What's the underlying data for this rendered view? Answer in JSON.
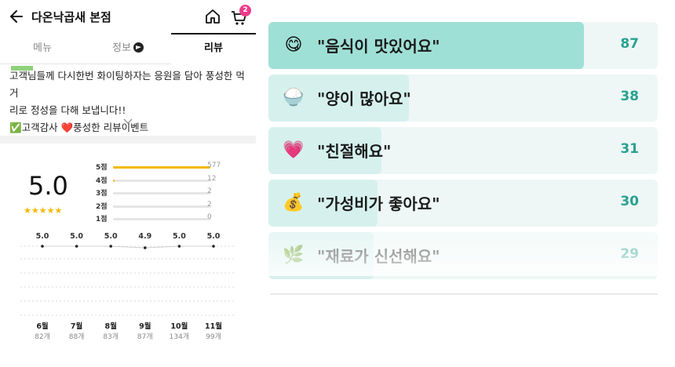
{
  "header": {
    "shop_name": "다온낙곱새 본점",
    "cart_count": "2"
  },
  "tabs": [
    {
      "label": "메뉴"
    },
    {
      "label": "정보"
    },
    {
      "label": "리뷰"
    }
  ],
  "notice": {
    "line1": "고객님들께 다시한번 화이팅하자는 응원을 담아 풍성한 먹거",
    "line2": "리로 정성을 다해 보냅니다!!",
    "line3": "✅고객감사 ❤️풍성한 리뷰이벤트"
  },
  "rating": {
    "score": "5.0",
    "stars": "★★★★★",
    "distribution": [
      {
        "label": "5점",
        "count": "577",
        "fraction": 1.0
      },
      {
        "label": "4점",
        "count": "12",
        "fraction": 0.02
      },
      {
        "label": "3점",
        "count": "2",
        "fraction": 0.0
      },
      {
        "label": "2점",
        "count": "2",
        "fraction": 0.0
      },
      {
        "label": "1점",
        "count": "0",
        "fraction": 0.0
      }
    ]
  },
  "trend": [
    {
      "month": "6월",
      "score": "5.0",
      "count": "82개"
    },
    {
      "month": "7월",
      "score": "5.0",
      "count": "88개"
    },
    {
      "month": "8월",
      "score": "5.0",
      "count": "83개"
    },
    {
      "month": "9월",
      "score": "4.9",
      "count": "87개"
    },
    {
      "month": "10월",
      "score": "5.0",
      "count": "134개"
    },
    {
      "month": "11월",
      "score": "5.0",
      "count": "99개"
    }
  ],
  "keywords": [
    {
      "emoji": "😋",
      "label": "\"음식이 맛있어요\"",
      "count": "87",
      "fraction": 0.81
    },
    {
      "emoji": "🍚",
      "label": "\"양이 많아요\"",
      "count": "38",
      "fraction": 0.36
    },
    {
      "emoji": "💗",
      "label": "\"친절해요\"",
      "count": "31",
      "fraction": 0.29
    },
    {
      "emoji": "💰",
      "label": "\"가성비가 좋아요\"",
      "count": "30",
      "fraction": 0.28
    },
    {
      "emoji": "🌿",
      "label": "\"재료가 신선해요\"",
      "count": "29",
      "fraction": 0.27
    }
  ],
  "colors": {
    "accent": "#2aa191",
    "bar_strong": "#9fe0d6",
    "bar_light": "#d6f1ed",
    "star": "#f5b800",
    "badge": "#ee3b8b"
  }
}
